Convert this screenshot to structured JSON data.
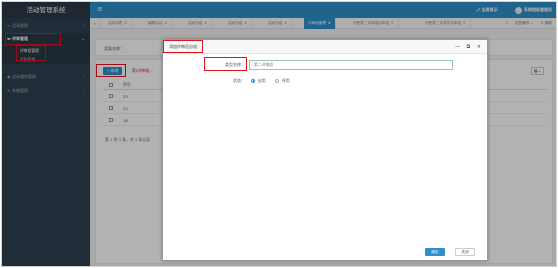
{
  "app": {
    "title": "活动管理系统"
  },
  "sidebar": {
    "items": [
      {
        "label": "活动管理",
        "icon": "chart-icon"
      },
      {
        "label": "评审管理",
        "icon": "ticket-icon"
      },
      {
        "label": "活动通知管理",
        "icon": "eye-icon"
      },
      {
        "label": "系统管理",
        "icon": "pencil-icon"
      }
    ],
    "subitems": [
      {
        "label": "评审组管理"
      },
      {
        "label": "奖励管理"
      }
    ]
  },
  "topbar": {
    "fullscreen": "全屏显示",
    "user": "系统超级管理员"
  },
  "tabs": [
    {
      "label": "活动列表"
    },
    {
      "label": "编辑活动"
    },
    {
      "label": "活动分组"
    },
    {
      "label": "活动分组"
    },
    {
      "label": "活动分组"
    },
    {
      "label": "评审组管理"
    },
    {
      "label": "分配第二评审组评审组"
    },
    {
      "label": "分配第二评审员评审组"
    }
  ],
  "tab_tools": {
    "more": "页签操作",
    "refresh": "刷新"
  },
  "search": {
    "label": "奖励名称："
  },
  "toolbar": {
    "add": "+ 新增",
    "hint": "第2评审组..."
  },
  "table": {
    "header": "序号",
    "rows": [
      "23",
      "22",
      "18"
    ],
    "pager": "第 1 到 3 条，共 3 条记录"
  },
  "modal": {
    "title": "添加评审员分组",
    "name_label": "类型名称：",
    "name_value": "第二评审组",
    "status_label": "状态：",
    "enabled": "启用",
    "disabled": "停用",
    "ok": "确定",
    "cancel": "关闭"
  }
}
